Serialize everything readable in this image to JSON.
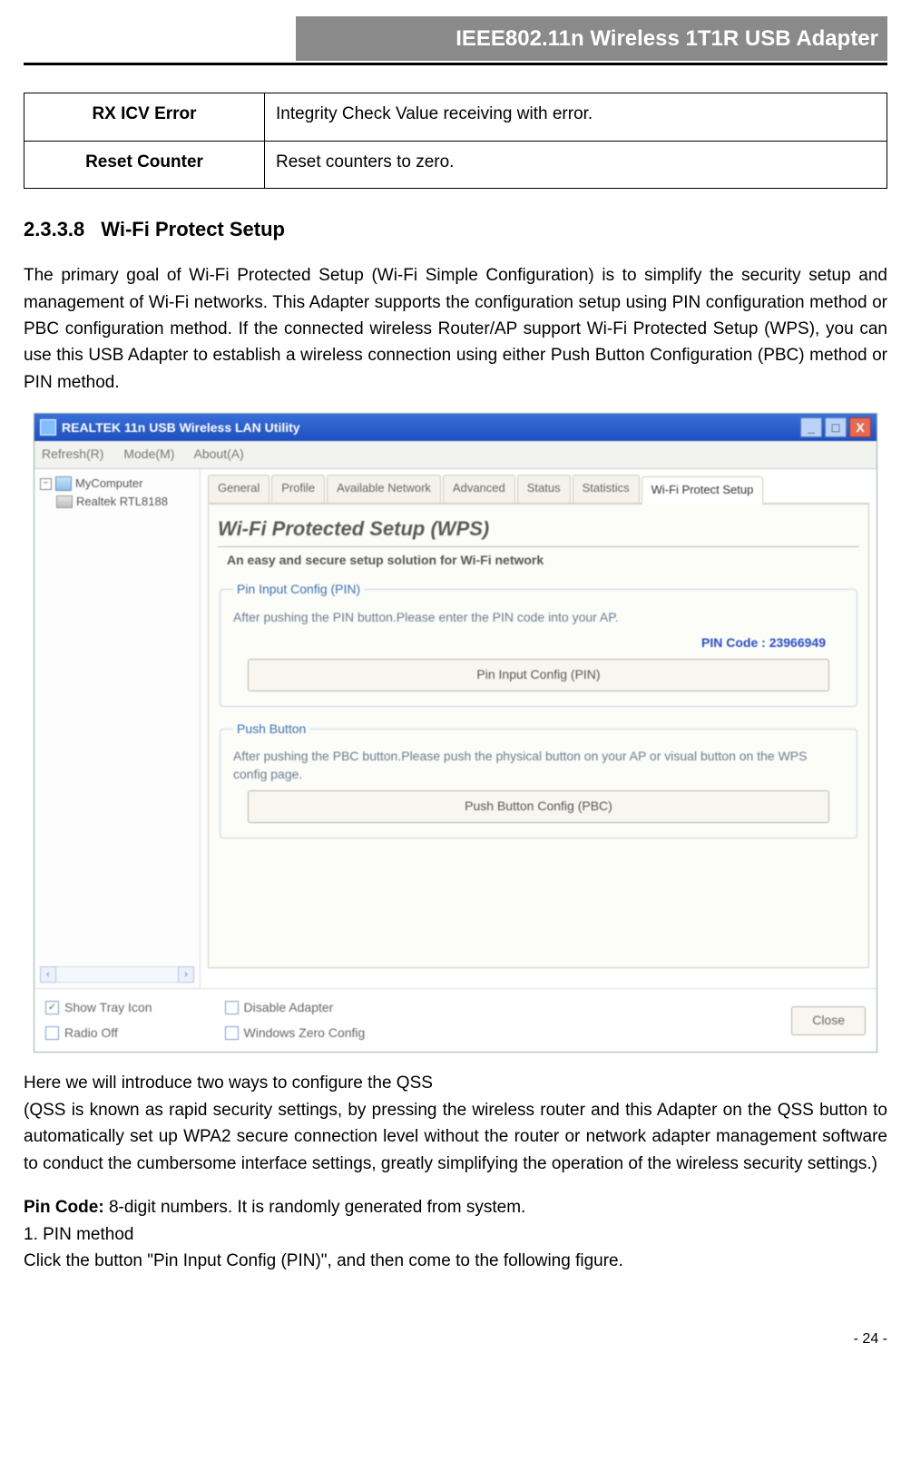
{
  "header": {
    "title": "IEEE802.11n Wireless 1T1R USB Adapter"
  },
  "defs_table": {
    "rows": [
      {
        "term": "RX ICV Error",
        "desc": "Integrity Check Value receiving with error."
      },
      {
        "term": "Reset Counter",
        "desc": "Reset counters to zero."
      }
    ]
  },
  "section": {
    "number": "2.3.3.8",
    "title": "Wi-Fi Protect Setup"
  },
  "para1": "The primary goal of Wi-Fi Protected Setup (Wi-Fi Simple Configuration) is to simplify the security setup and management of Wi-Fi networks. This Adapter supports the configuration setup using PIN configuration method or PBC configuration method. If the connected wireless Router/AP support Wi-Fi Protected Setup (WPS), you can use this USB Adapter to establish a wireless connection using either Push Button Configuration (PBC) method or PIN method.",
  "para2": "Here we will introduce two ways to configure the QSS",
  "para3": "(QSS is known as rapid security settings, by pressing the wireless router and this Adapter on the QSS button to automatically set up WPA2 secure connection level without the router or network adapter management software to conduct the cumbersome interface settings, greatly simplifying the operation of the wireless security settings.)",
  "pin_code_label": "Pin Code:",
  "pin_code_desc": " 8-digit numbers. It is randomly generated from system.",
  "list_item_1": "1.  PIN method",
  "para4": "Click the button \"Pin Input Config (PIN)\", and then come to the following figure.",
  "page_number": "- 24 -",
  "screenshot": {
    "window_title": "REALTEK 11n USB Wireless LAN Utility",
    "menus": [
      "Refresh(R)",
      "Mode(M)",
      "About(A)"
    ],
    "tree": {
      "root": "MyComputer",
      "child": "Realtek RTL8188"
    },
    "tabs": [
      "General",
      "Profile",
      "Available Network",
      "Advanced",
      "Status",
      "Statistics",
      "Wi-Fi Protect Setup"
    ],
    "wps_heading": "Wi-Fi Protected Setup (WPS)",
    "wps_sub": "An easy and secure setup solution for Wi-Fi network",
    "pin_group": {
      "legend": "Pin Input Config (PIN)",
      "desc": "After pushing the PIN button.Please enter the PIN code into your AP.",
      "pin_label": "PIN Code :  23966949",
      "button": "Pin Input Config (PIN)"
    },
    "pbc_group": {
      "legend": "Push Button",
      "desc": "After pushing the PBC button.Please push the physical button on your AP or visual button on the WPS config page.",
      "button": "Push Button Config (PBC)"
    },
    "footer": {
      "show_tray": "Show Tray Icon",
      "radio_off": "Radio Off",
      "disable_adapter": "Disable Adapter",
      "win_zero": "Windows Zero Config",
      "close": "Close"
    }
  }
}
